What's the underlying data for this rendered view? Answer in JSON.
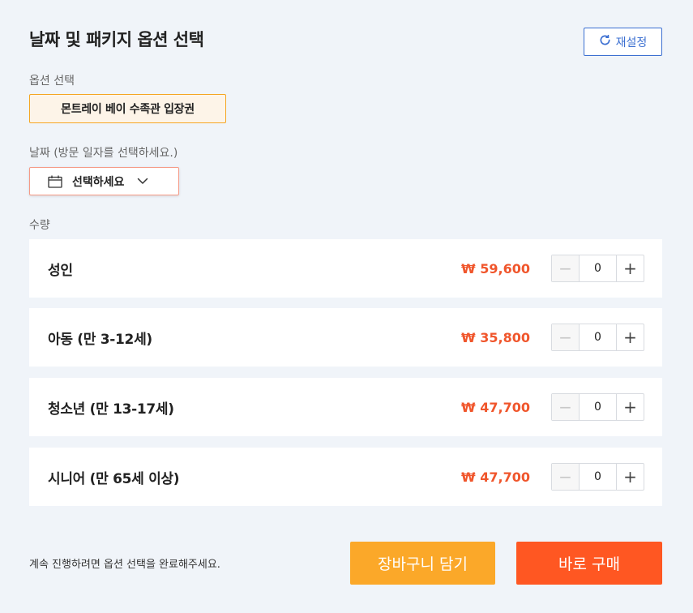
{
  "header": {
    "title": "날짜 및 패키지 옵션 선택",
    "reset_label": "재설정"
  },
  "option": {
    "label": "옵션 선택",
    "selected": "몬트레이 베이 수족관 입장권"
  },
  "date": {
    "label": "날짜  (방문 일자를 선택하세요.)",
    "placeholder": "선택하세요"
  },
  "quantity": {
    "label": "수량",
    "rows": [
      {
        "name": "성인",
        "price": "₩ 59,600",
        "count": "0"
      },
      {
        "name": "아동 (만 3-12세)",
        "price": "₩ 35,800",
        "count": "0"
      },
      {
        "name": "청소년 (만 13-17세)",
        "price": "₩ 47,700",
        "count": "0"
      },
      {
        "name": "시니어 (만 65세 이상)",
        "price": "₩ 47,700",
        "count": "0"
      }
    ],
    "minus_glyph": "−",
    "plus_glyph": "+"
  },
  "footer": {
    "note": "계속 진행하려면 옵션 선택을 완료해주세요.",
    "cart_label": "장바구니 담기",
    "buy_label": "바로 구매"
  },
  "colors": {
    "accent_blue": "#3b6fd1",
    "price_orange": "#f0562c",
    "cart_yellow": "#fba829",
    "buy_orange": "#ff5722"
  },
  "icons": {
    "reset": "refresh-icon",
    "date": "calendar-icon",
    "dropdown": "chevron-down-icon"
  }
}
